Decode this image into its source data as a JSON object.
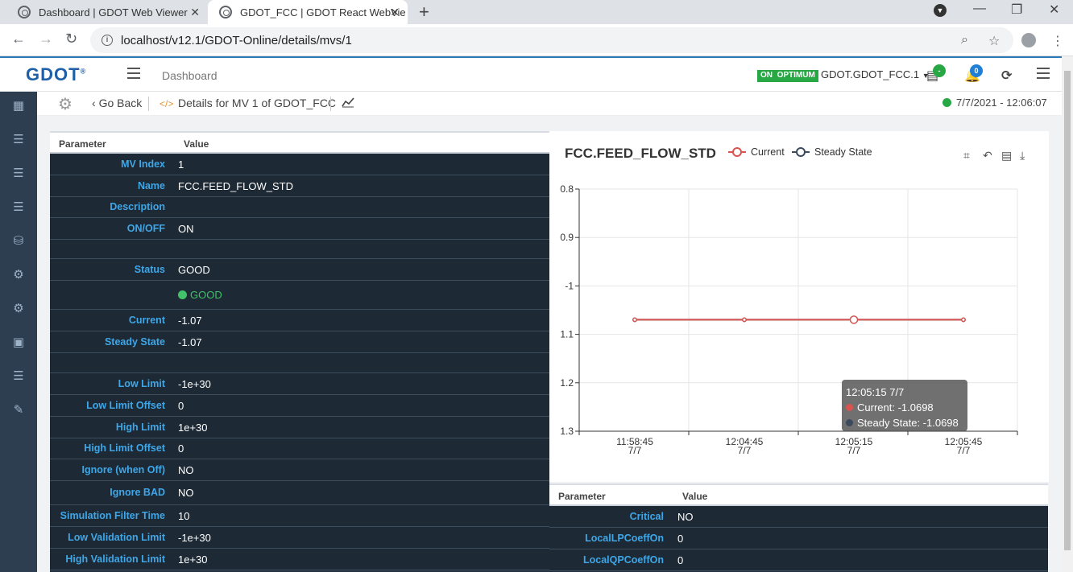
{
  "browser": {
    "tabs": [
      {
        "title": "Dashboard | GDOT Web Viewer",
        "active": false
      },
      {
        "title": "GDOT_FCC | GDOT React WebVie",
        "active": true
      }
    ],
    "url": "localhost/v12.1/GDOT-Online/details/mvs/1"
  },
  "header": {
    "logo": "GDOT",
    "logo_mark": "®",
    "breadcrumb": "Dashboard",
    "status_on": "ON",
    "status_mode": "OPTIMUM",
    "app_name": "GDOT.GDOT_FCC.1",
    "notifications_count": "0",
    "server_badge": "-"
  },
  "toolbar": {
    "go_back": "Go Back",
    "details_title": "Details for MV 1 of GDOT_FCC",
    "timestamp": "7/7/2021 - 12:06:07"
  },
  "left_table": {
    "col_param": "Parameter",
    "col_value": "Value",
    "rows": [
      {
        "label": "MV Index",
        "value": "1"
      },
      {
        "label": "Name",
        "value": "FCC.FEED_FLOW_STD"
      },
      {
        "label": "Description",
        "value": ""
      },
      {
        "label": "ON/OFF",
        "value": "ON"
      },
      {
        "label": "",
        "value": ""
      },
      {
        "label": "Status",
        "value": "GOOD"
      },
      {
        "label": "",
        "value": "GOOD"
      },
      {
        "label": "Current",
        "value": "-1.07"
      },
      {
        "label": "Steady State",
        "value": "-1.07"
      },
      {
        "label": "",
        "value": ""
      },
      {
        "label": "Low Limit",
        "value": "-1e+30"
      },
      {
        "label": "Low Limit Offset",
        "value": "0"
      },
      {
        "label": "High Limit",
        "value": "1e+30"
      },
      {
        "label": "High Limit Offset",
        "value": "0"
      },
      {
        "label": "Ignore (when Off)",
        "value": "NO"
      },
      {
        "label": "Ignore BAD",
        "value": "NO"
      },
      {
        "label": "Simulation Filter Time",
        "value": "10"
      },
      {
        "label": "Low Validation Limit",
        "value": "-1e+30"
      },
      {
        "label": "High Validation Limit",
        "value": "1e+30"
      }
    ]
  },
  "right_table": {
    "col_param": "Parameter",
    "col_value": "Value",
    "rows": [
      {
        "label": "Critical",
        "value": "NO"
      },
      {
        "label": "LocalLPCoeffOn",
        "value": "0"
      },
      {
        "label": "LocalQPCoeffOn",
        "value": "0"
      }
    ]
  },
  "tooltip": {
    "header": "12:05:15 7/7",
    "current": "Current: -1.0698",
    "steady": "Steady State: -1.0698"
  },
  "chart_data": {
    "type": "line",
    "title": "FCC.FEED_FLOW_STD",
    "legend": [
      "Current",
      "Steady State"
    ],
    "y_ticks": [
      "0.8",
      "0.9",
      "-1",
      "1.1",
      "1.2",
      "1.3"
    ],
    "x_ticks": [
      {
        "time": "11:58:45",
        "date": "7/7"
      },
      {
        "time": "12:04:45",
        "date": "7/7"
      },
      {
        "time": "12:05:15",
        "date": "7/7"
      },
      {
        "time": "12:05:45",
        "date": "7/7"
      }
    ],
    "series": [
      {
        "name": "Current",
        "color": "#d9534f",
        "values": [
          -1.0698,
          -1.0698,
          -1.0698,
          -1.0698
        ]
      },
      {
        "name": "Steady State",
        "color": "#3b4a5c",
        "values": [
          -1.0698,
          -1.0698,
          -1.0698,
          -1.0698
        ]
      }
    ],
    "legend_position": "top",
    "grid": true
  },
  "colors": {
    "accent": "#2a7ab8",
    "sidebar": "#2d3e50",
    "row_bg": "#1d2935",
    "label": "#3fa7e8",
    "good": "#42c06a"
  }
}
